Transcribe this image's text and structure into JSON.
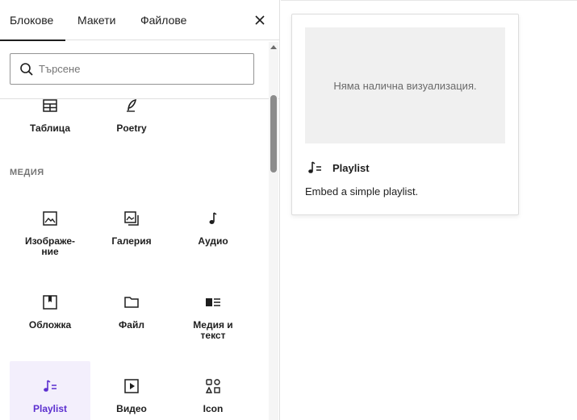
{
  "tabs": [
    {
      "label": "Блокове",
      "active": true
    },
    {
      "label": "Макети",
      "active": false
    },
    {
      "label": "Файлове",
      "active": false
    }
  ],
  "search": {
    "placeholder": "Търсене"
  },
  "blocks_top": [
    {
      "label": "Таблица",
      "icon": "table-icon"
    },
    {
      "label": "Poetry",
      "icon": "feather-icon"
    }
  ],
  "category": {
    "title": "МЕДИЯ"
  },
  "media_blocks": [
    {
      "label": "Изображе-\nние",
      "icon": "image-icon"
    },
    {
      "label": "Галерия",
      "icon": "gallery-icon"
    },
    {
      "label": "Аудио",
      "icon": "audio-icon"
    },
    {
      "label": "Обложка",
      "icon": "cover-icon"
    },
    {
      "label": "Файл",
      "icon": "folder-icon"
    },
    {
      "label": "Медия и\nтекст",
      "icon": "media-text-icon"
    },
    {
      "label": "Playlist",
      "icon": "playlist-icon",
      "selected": true
    },
    {
      "label": "Видео",
      "icon": "video-icon"
    },
    {
      "label": "Icon",
      "icon": "icon-block-icon"
    }
  ],
  "preview": {
    "no_preview": "Няма налична визуализация.",
    "title": "Playlist",
    "description": "Embed a simple playlist."
  },
  "colors": {
    "accent": "#5b2ecf",
    "selected_bg": "#f3effc"
  }
}
